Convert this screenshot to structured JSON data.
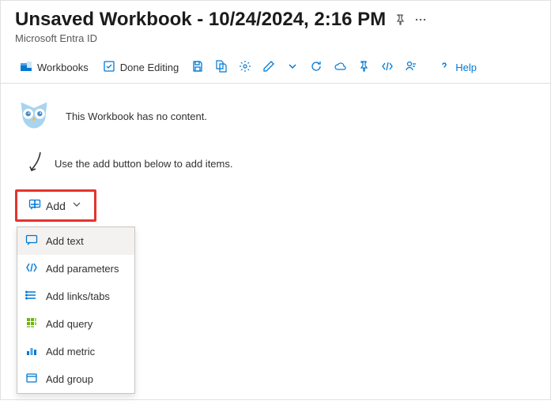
{
  "header": {
    "title": "Unsaved Workbook - 10/24/2024, 2:16 PM",
    "subtitle": "Microsoft Entra ID"
  },
  "toolbar": {
    "workbooks": "Workbooks",
    "done_editing": "Done Editing",
    "help": "Help"
  },
  "content": {
    "empty_msg": "This Workbook has no content.",
    "hint_msg": "Use the add button below to add items.",
    "add_label": "Add"
  },
  "menu": {
    "items": [
      {
        "label": "Add text"
      },
      {
        "label": "Add parameters"
      },
      {
        "label": "Add links/tabs"
      },
      {
        "label": "Add query"
      },
      {
        "label": "Add metric"
      },
      {
        "label": "Add group"
      }
    ]
  }
}
